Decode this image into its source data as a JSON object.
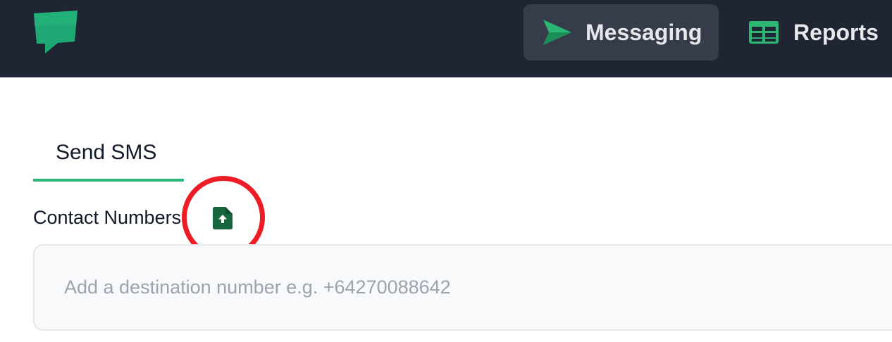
{
  "header": {
    "logo_icon": "chat-bubble-logo-icon",
    "nav": [
      {
        "label": "Messaging",
        "icon": "send-icon",
        "active": true
      },
      {
        "label": "Reports",
        "icon": "table-icon",
        "active": false
      }
    ]
  },
  "tabs": [
    {
      "label": "Send SMS",
      "active": true
    }
  ],
  "form": {
    "contact_numbers_label": "Contact Numbers",
    "upload_icon": "file-upload-icon",
    "destination_placeholder": "Add a destination number e.g. +64270088642",
    "destination_value": ""
  },
  "colors": {
    "header_bg": "#1f2533",
    "accent_green": "#2bb673",
    "upload_icon_green": "#17663f",
    "highlight_red": "#ee1c25"
  }
}
